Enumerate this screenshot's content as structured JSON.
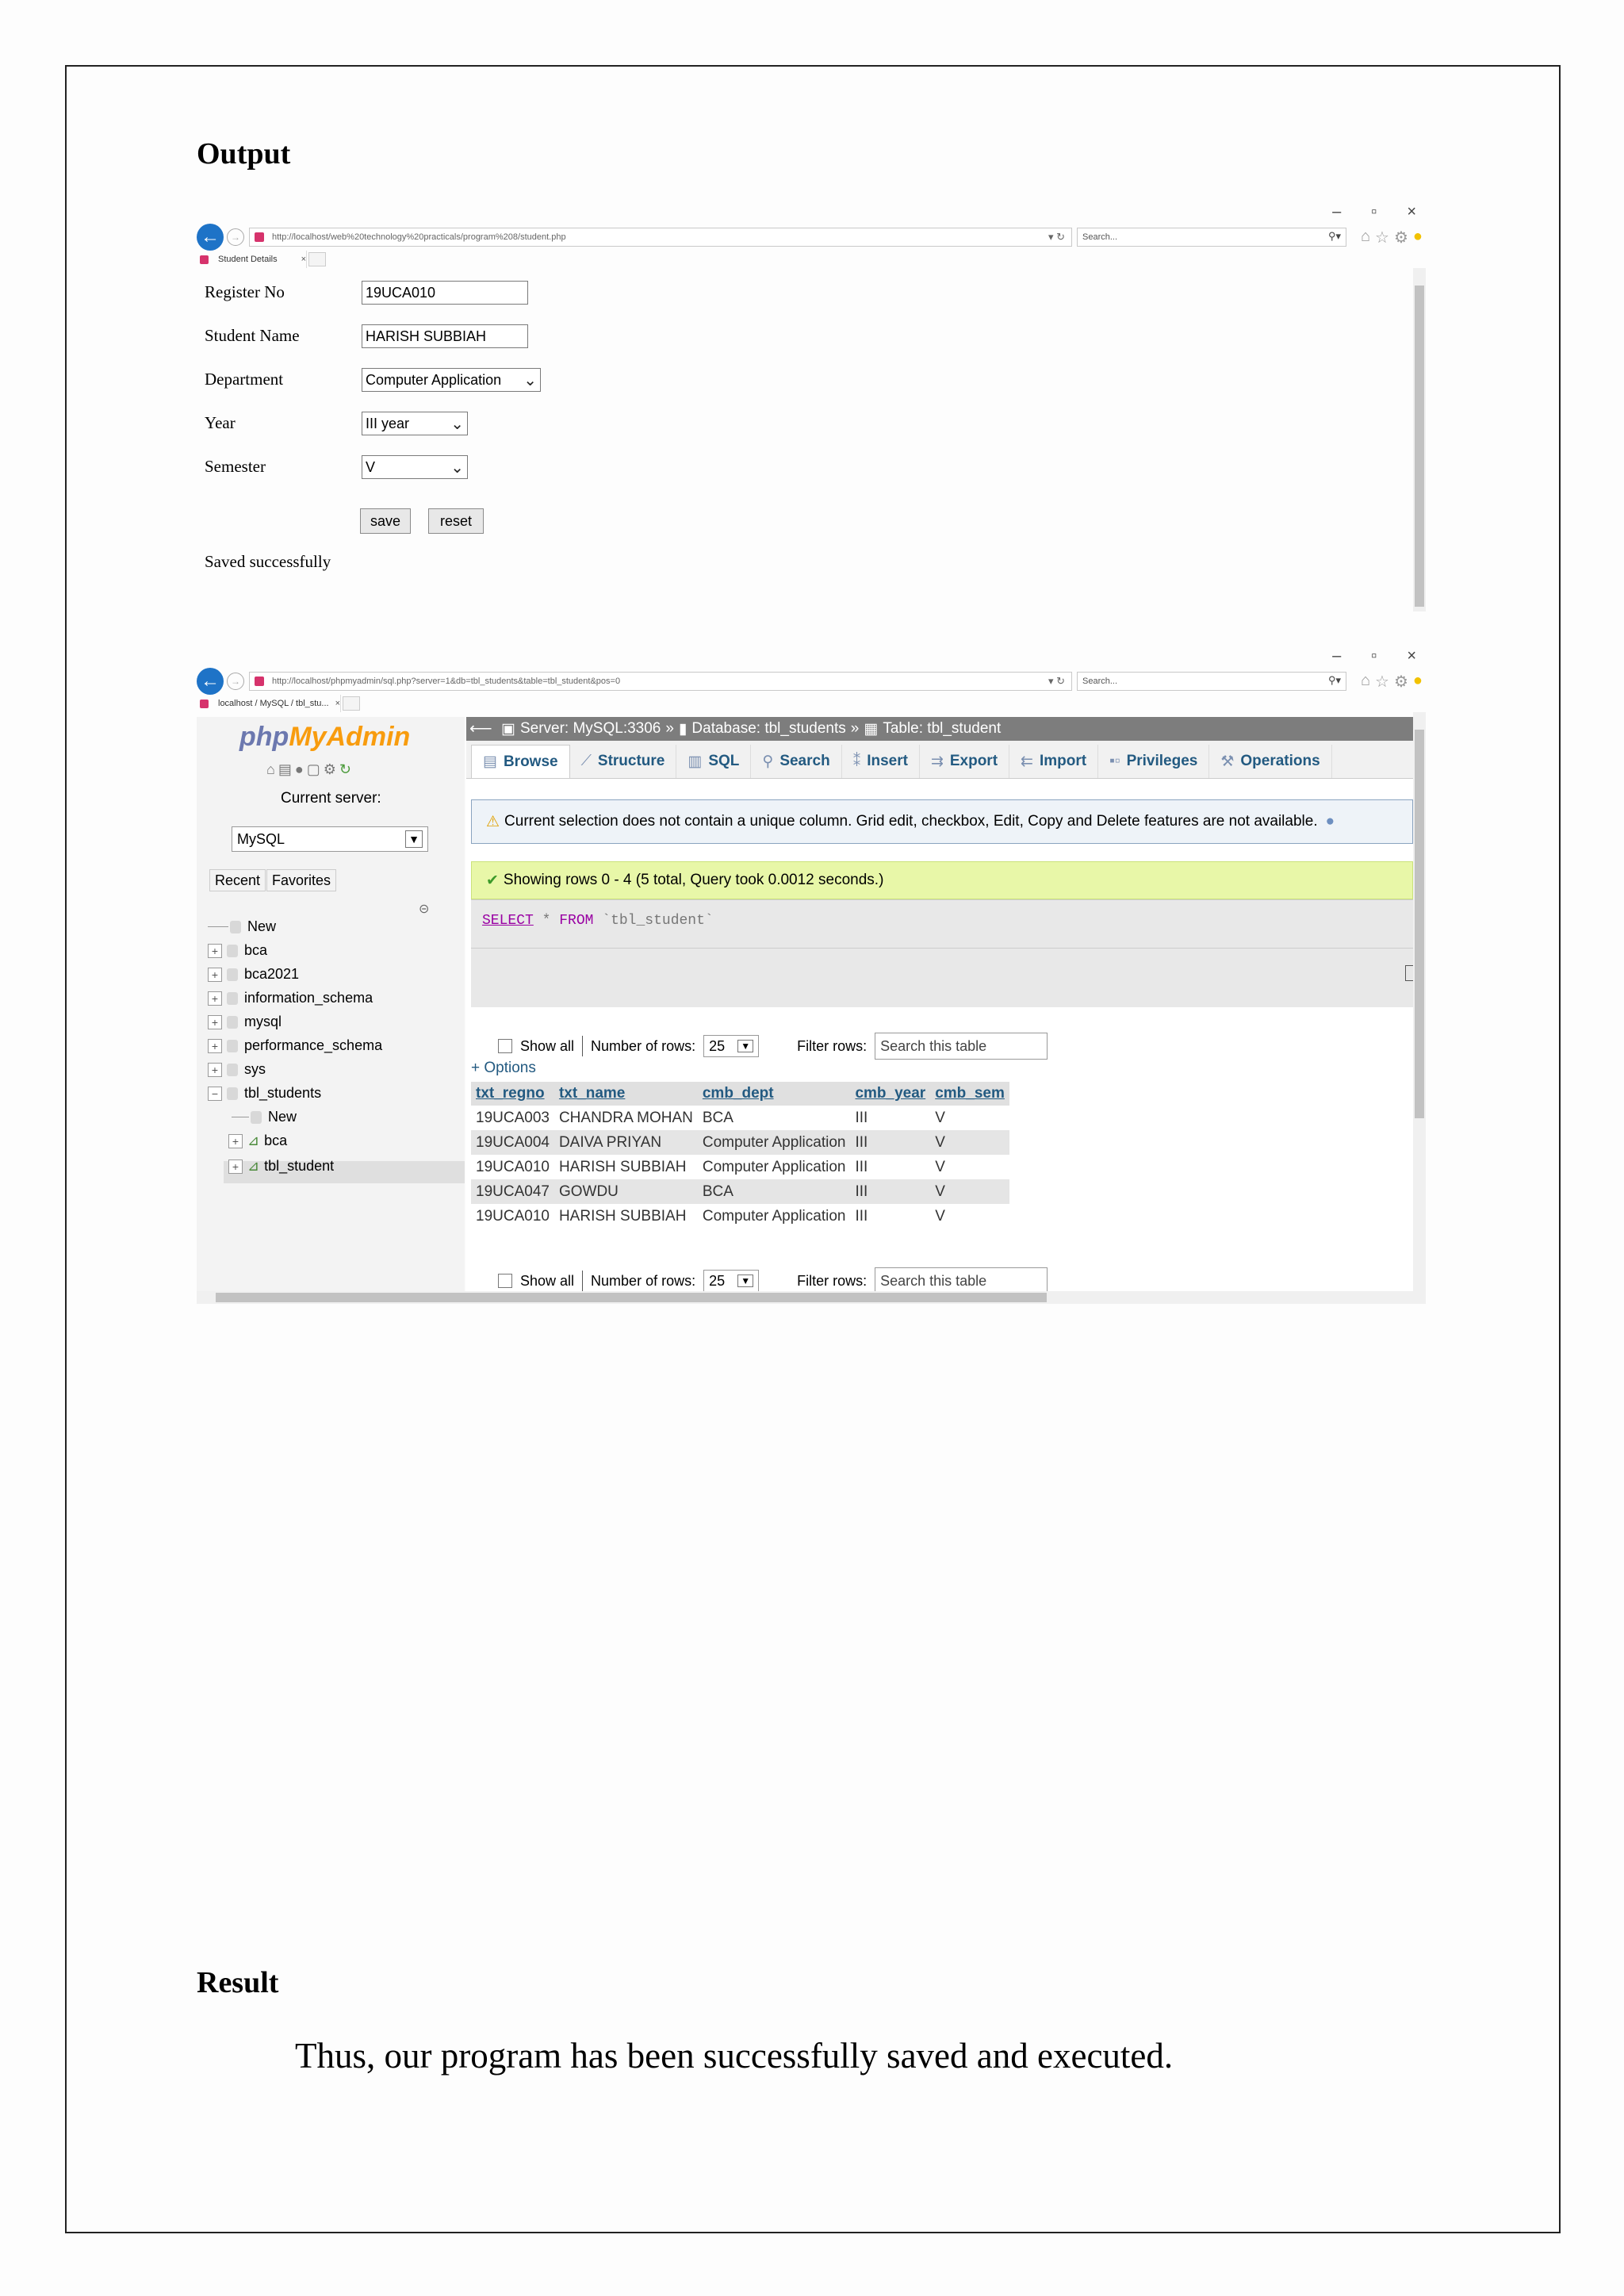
{
  "document": {
    "output_heading": "Output",
    "result_heading": "Result",
    "result_text": "Thus, our program has been successfully saved and executed."
  },
  "browser1": {
    "url": "http://localhost/web%20technology%20practicals/program%208/student.php",
    "search_placeholder": "Search...",
    "tab_title": "Student Details",
    "form": {
      "register_no_label": "Register No",
      "register_no_value": "19UCA010",
      "student_name_label": "Student Name",
      "student_name_value": "HARISH SUBBIAH",
      "department_label": "Department",
      "department_value": "Computer Application",
      "year_label": "Year",
      "year_value": "III year",
      "semester_label": "Semester",
      "semester_value": "V",
      "save_label": "save",
      "reset_label": "reset",
      "status_message": "Saved successfully"
    }
  },
  "browser2": {
    "url": "http://localhost/phpmyadmin/sql.php?server=1&db=tbl_students&table=tbl_student&pos=0",
    "search_placeholder": "Search...",
    "tab_title": "localhost / MySQL / tbl_stu...",
    "pma": {
      "logo_php": "php",
      "logo_my": "My",
      "logo_admin": "Admin",
      "current_server_label": "Current server:",
      "server_value": "MySQL",
      "recent_label": "Recent",
      "favorites_label": "Favorites",
      "tree": [
        {
          "label": "New"
        },
        {
          "label": "bca"
        },
        {
          "label": "bca2021"
        },
        {
          "label": "information_schema"
        },
        {
          "label": "mysql"
        },
        {
          "label": "performance_schema"
        },
        {
          "label": "sys"
        },
        {
          "label": "tbl_students"
        },
        {
          "label": "New"
        },
        {
          "label": "bca"
        },
        {
          "label": "tbl_student"
        }
      ],
      "breadcrumb": {
        "server": "Server: MySQL:3306",
        "database": "Database: tbl_students",
        "table": "Table: tbl_student",
        "sep": "»"
      },
      "tabs": [
        {
          "label": "Browse",
          "icon": "browse-icon"
        },
        {
          "label": "Structure",
          "icon": "structure-icon"
        },
        {
          "label": "SQL",
          "icon": "sql-icon"
        },
        {
          "label": "Search",
          "icon": "search-icon"
        },
        {
          "label": "Insert",
          "icon": "insert-icon"
        },
        {
          "label": "Export",
          "icon": "export-icon"
        },
        {
          "label": "Import",
          "icon": "import-icon"
        },
        {
          "label": "Privileges",
          "icon": "privileges-icon"
        },
        {
          "label": "Operations",
          "icon": "operations-icon"
        }
      ],
      "notice": "Current selection does not contain a unique column. Grid edit, checkbox, Edit, Copy and Delete features are not available.",
      "success": "Showing rows 0 - 4 (5 total, Query took 0.0012 seconds.)",
      "sql_select": "SELECT",
      "sql_star": "*",
      "sql_from": "FROM",
      "sql_table": "`tbl_student`",
      "show_all_label": "Show all",
      "number_of_rows_label": "Number of rows:",
      "rows_value": "25",
      "filter_label": "Filter rows:",
      "filter_placeholder": "Search this table",
      "options_label": "+ Options",
      "columns": [
        "txt_regno",
        "txt_name",
        "cmb_dept",
        "cmb_year",
        "cmb_sem"
      ],
      "rows": [
        [
          "19UCA003",
          "CHANDRA MOHAN",
          "BCA",
          "III",
          "V"
        ],
        [
          "19UCA004",
          "DAIVA PRIYAN",
          "Computer Application",
          "III",
          "V"
        ],
        [
          "19UCA010",
          "HARISH SUBBIAH",
          "Computer Application",
          "III",
          "V"
        ],
        [
          "19UCA047",
          "GOWDU",
          "BCA",
          "III",
          "V"
        ],
        [
          "19UCA010",
          "HARISH SUBBIAH",
          "Computer Application",
          "III",
          "V"
        ]
      ]
    }
  }
}
